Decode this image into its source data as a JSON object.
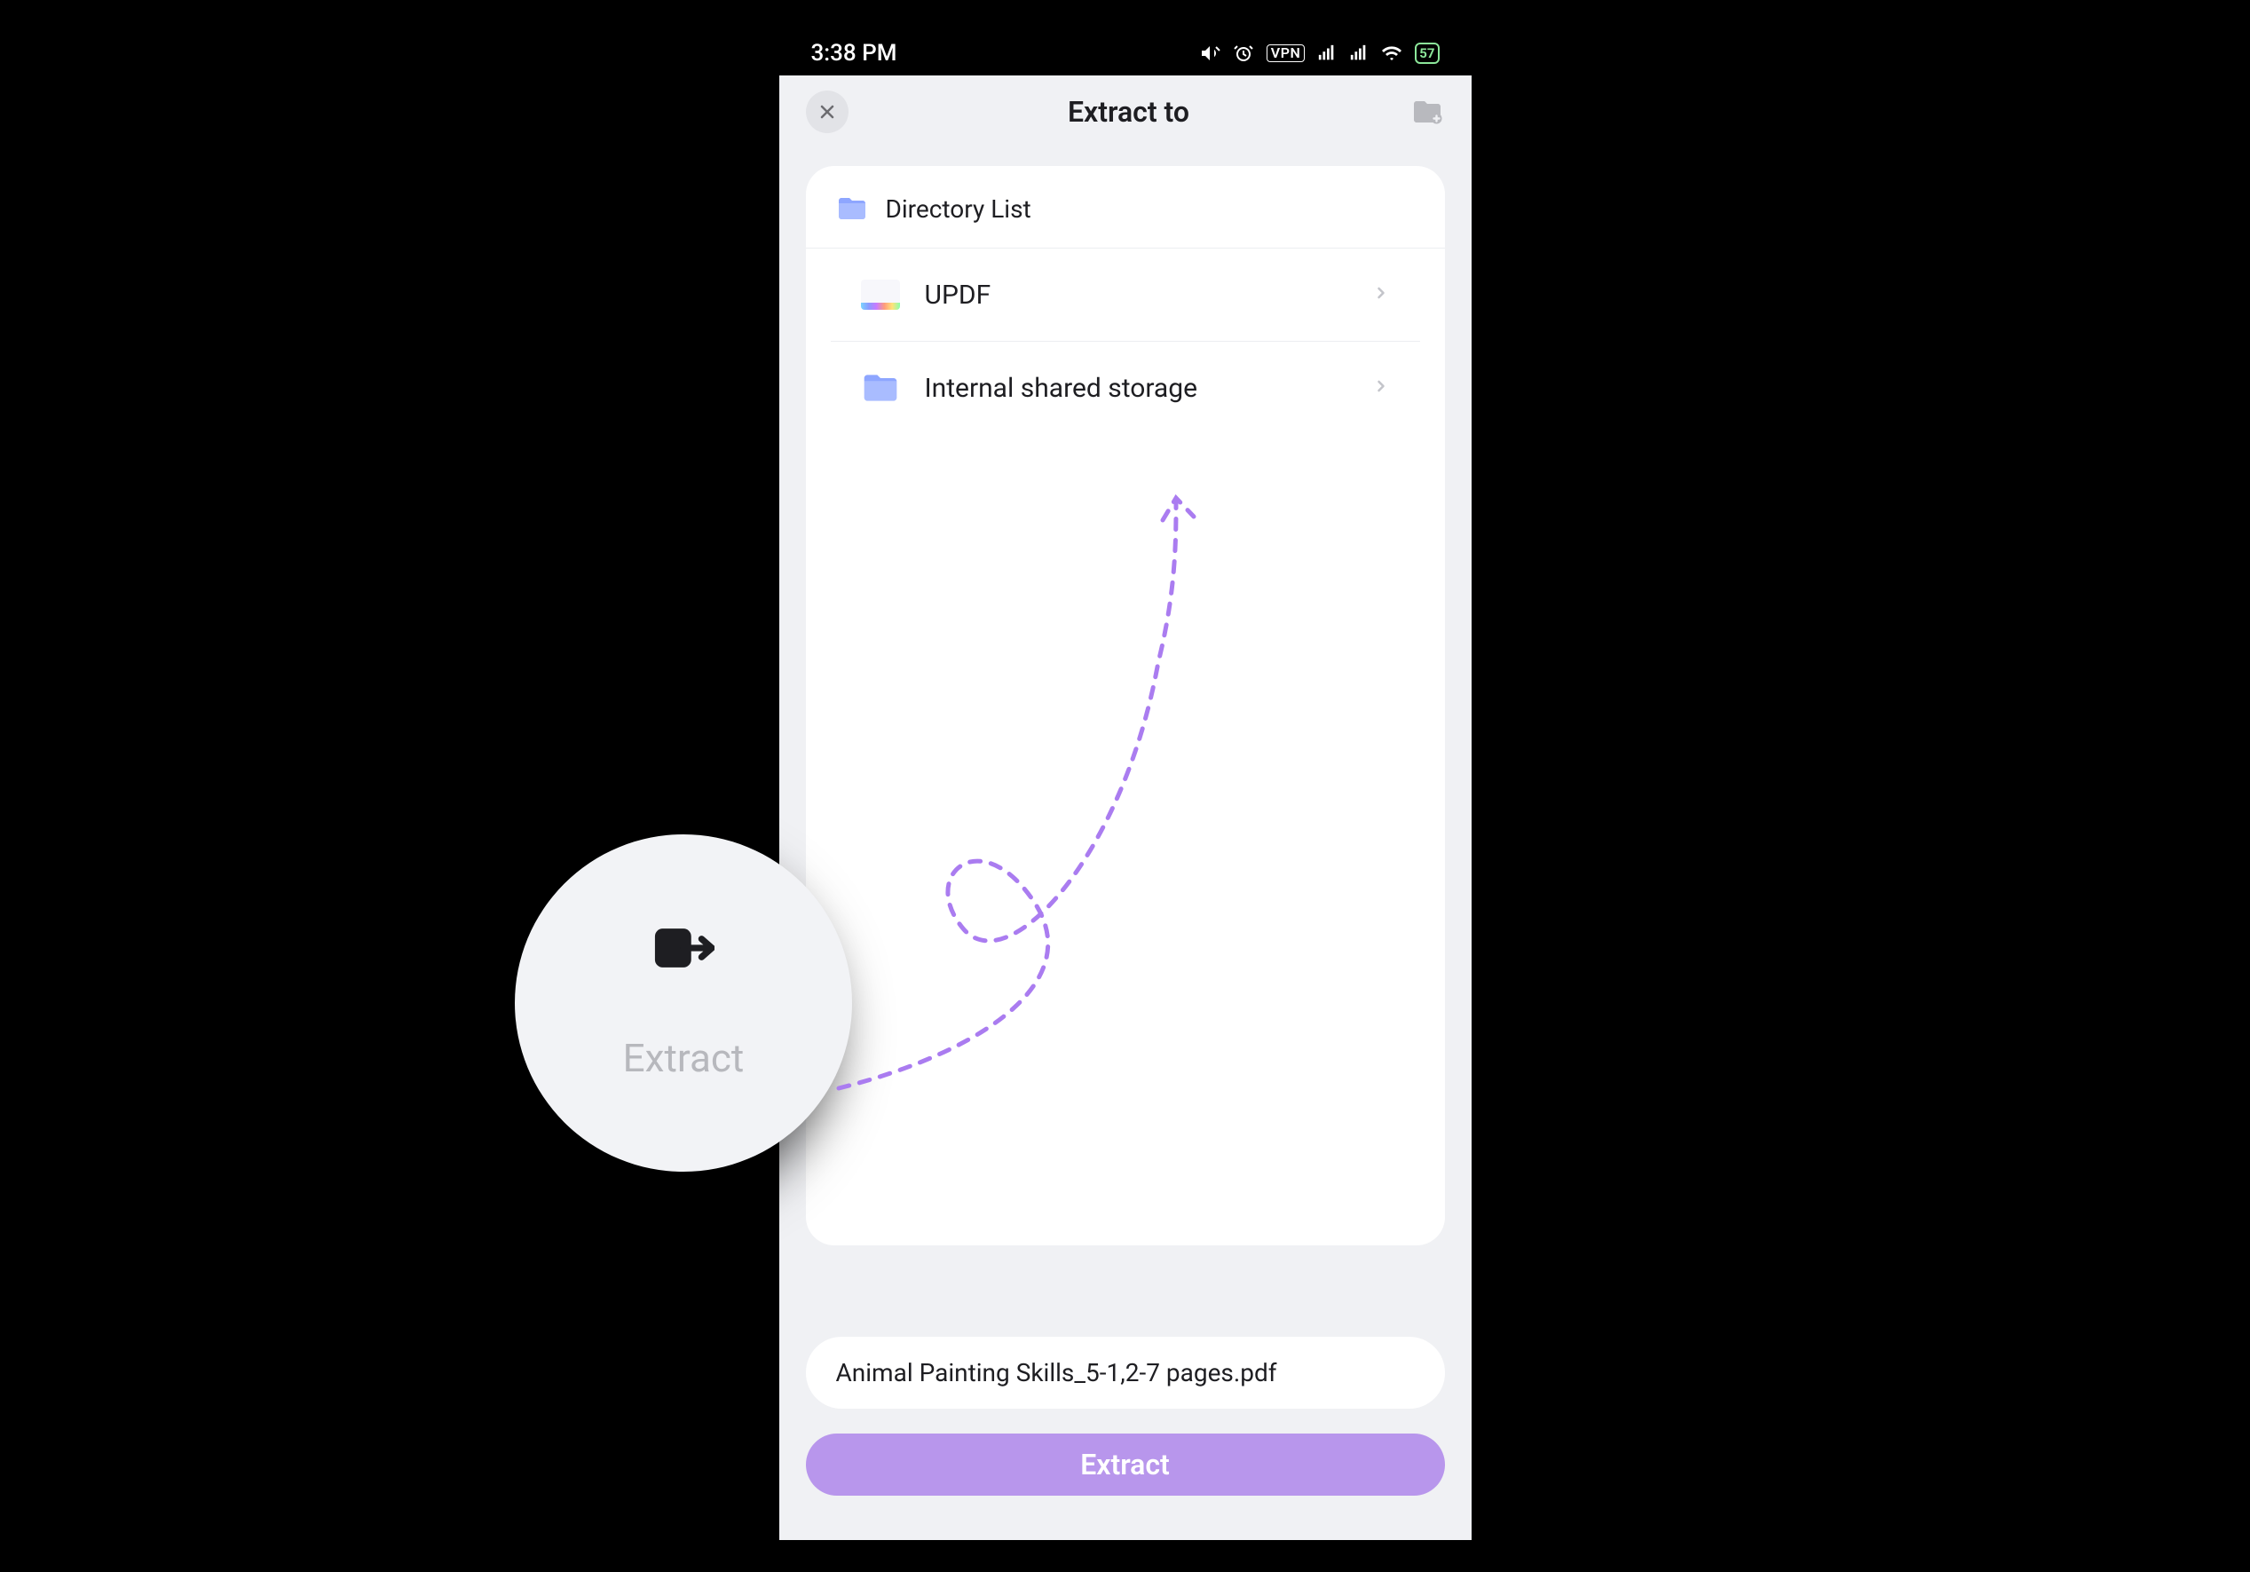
{
  "statusbar": {
    "time": "3:38 PM",
    "indicators": {
      "volume_muted": true,
      "alarm": true,
      "vpn_label": "VPN",
      "signal_bars": 2,
      "wifi": true,
      "battery_percent": 57
    }
  },
  "header": {
    "close": "✕",
    "title": "Extract to",
    "folder_action": "add-folder"
  },
  "directory_list": {
    "label": "Directory List",
    "items": [
      {
        "id": "updf",
        "label": "UPDF",
        "icon": "updf-icon"
      },
      {
        "id": "storage",
        "label": "Internal shared storage",
        "icon": "folder-icon"
      }
    ]
  },
  "filename": {
    "value": "Animal Painting Skills_5-1,2-7 pages.pdf"
  },
  "primary_action": {
    "label": "Extract"
  },
  "callout": {
    "label": "Extract",
    "icon": "export-icon"
  },
  "annotation_arrow": {
    "color": "#aa7cf0",
    "style": "dashed-curve"
  }
}
